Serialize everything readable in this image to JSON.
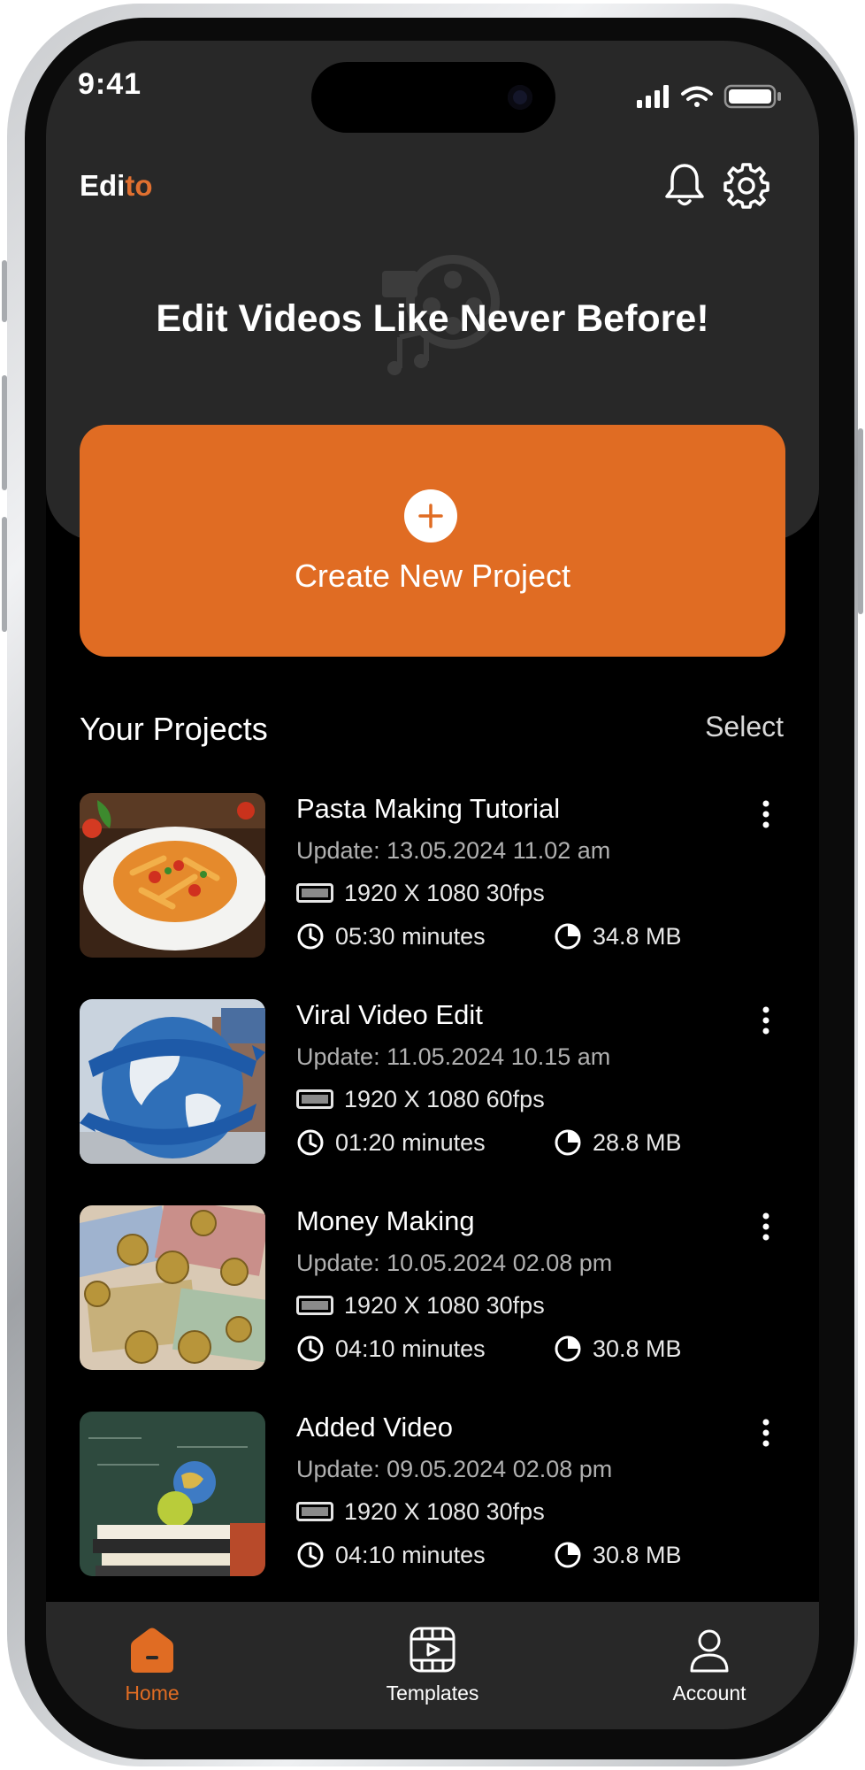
{
  "status_bar": {
    "time": "9:41"
  },
  "header": {
    "logo_main": "Edi",
    "logo_accent": "to",
    "notification_icon": "bell-icon",
    "settings_icon": "gear-icon"
  },
  "hero": {
    "title": "Edit Videos Like Never Before!"
  },
  "create_project": {
    "label": "Create New Project",
    "icon": "plus-circle-icon"
  },
  "projects_section": {
    "title": "Your Projects",
    "select_label": "Select",
    "items": [
      {
        "title": "Pasta Making Tutorial",
        "update": "Update: 13.05.2024  11.02 am",
        "resolution": "1920 X 1080  30fps",
        "duration": "05:30 minutes",
        "size": "34.8 MB"
      },
      {
        "title": "Viral Video Edit",
        "update": "Update: 11.05.2024  10.15 am",
        "resolution": "1920 X 1080  60fps",
        "duration": "01:20 minutes",
        "size": "28.8 MB"
      },
      {
        "title": "Money Making",
        "update": "Update: 10.05.2024  02.08 pm",
        "resolution": "1920 X 1080  30fps",
        "duration": "04:10 minutes",
        "size": "30.8 MB"
      },
      {
        "title": "Added Video",
        "update": "Update: 09.05.2024  02.08 pm",
        "resolution": "1920 X 1080  30fps",
        "duration": "04:10 minutes",
        "size": "30.8 MB"
      }
    ]
  },
  "bottom_nav": {
    "items": [
      {
        "label": "Home",
        "icon": "home-icon",
        "active": true
      },
      {
        "label": "Templates",
        "icon": "film-icon",
        "active": false
      },
      {
        "label": "Account",
        "icon": "user-icon",
        "active": false
      }
    ]
  },
  "colors": {
    "accent": "#e06c23",
    "background": "#000000",
    "surface": "#282828",
    "text": "#ffffff"
  }
}
